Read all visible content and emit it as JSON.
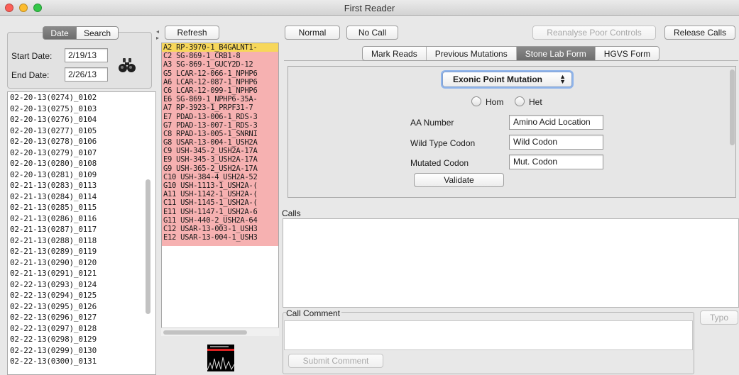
{
  "window": {
    "title": "First Reader"
  },
  "search_panel": {
    "tab_date": "Date",
    "tab_search": "Search",
    "start_label": "Start Date:",
    "start_value": "2/19/13",
    "end_label": "End Date:",
    "end_value": "2/26/13",
    "icon": "binoculars-icon"
  },
  "runs": [
    "02-20-13(0274)_0102",
    "02-20-13(0275)_0103",
    "02-20-13(0276)_0104",
    "02-20-13(0277)_0105",
    "02-20-13(0278)_0106",
    "02-20-13(0279)_0107",
    "02-20-13(0280)_0108",
    "02-20-13(0281)_0109",
    "02-21-13(0283)_0113",
    "02-21-13(0284)_0114",
    "02-21-13(0285)_0115",
    "02-21-13(0286)_0116",
    "02-21-13(0287)_0117",
    "02-21-13(0288)_0118",
    "02-21-13(0289)_0119",
    "02-21-13(0290)_0120",
    "02-21-13(0291)_0121",
    "02-22-13(0293)_0124",
    "02-22-13(0294)_0125",
    "02-22-13(0295)_0126",
    "02-22-13(0296)_0127",
    "02-22-13(0297)_0128",
    "02-22-13(0298)_0129",
    "02-22-13(0299)_0130",
    "02-22-13(0300)_0131"
  ],
  "toolbar": {
    "refresh": "Refresh",
    "normal": "Normal",
    "no_call": "No Call",
    "reanalyse": "Reanalyse Poor Controls",
    "release": "Release Calls"
  },
  "wells": [
    "A2 RP-3970-1_B4GALNT1-",
    "C2 SG-869-1_CRB1-8",
    "A3 SG-869-1_GUCY2D-12",
    "G5 LCAR-12-066-1_NPHP6",
    "A6 LCAR-12-087-1_NPHP6",
    "C6 LCAR-12-099-1_NPHP6",
    "E6 SG-869-1_NPHP6-35A-",
    "A7 RP-3923-1_PRPF31-7",
    "E7 PDAD-13-006-1_RDS-3",
    "G7 PDAD-13-007-1_RDS-3",
    "C8 RPAD-13-005-1_SNRNI",
    "G8 USAR-13-004-1_USH2A",
    "C9 USH-345-2_USH2A-17A",
    "E9 USH-345-3_USH2A-17A",
    "G9 USH-365-2_USH2A-17A",
    "C10 USH-384-4_USH2A-52",
    "G10 USH-1113-1_USH2A-(",
    "A11 USH-1142-1_USH2A-(",
    "C11 USH-1145-1_USH2A-(",
    "E11 USH-1147-1_USH2A-6",
    "G11 USH-440-2_USH2A-64",
    "C12 USAR-13-003-1_USH3",
    "E12 USAR-13-004-1_USH3"
  ],
  "tabs": [
    "Mark Reads",
    "Previous Mutations",
    "Stone Lab Form",
    "HGVS Form"
  ],
  "form": {
    "mutation_type": "Exonic Point Mutation",
    "hom_label": "Hom",
    "het_label": "Het",
    "aa_number_label": "AA Number",
    "aa_number_value": "Amino Acid Location",
    "wild_label": "Wild Type Codon",
    "wild_value": "Wild Codon",
    "mutated_label": "Mutated Codon",
    "mutated_value": "Mut. Codon",
    "validate": "Validate"
  },
  "calls_label": "Calls",
  "comment": {
    "label": "Call Comment",
    "submit": "Submit Comment",
    "typo": "Typo"
  },
  "colors": {
    "well_bg": "#f6b1b1",
    "well_selected": "#f7d75a",
    "focus_ring": "#8fb4ea"
  }
}
